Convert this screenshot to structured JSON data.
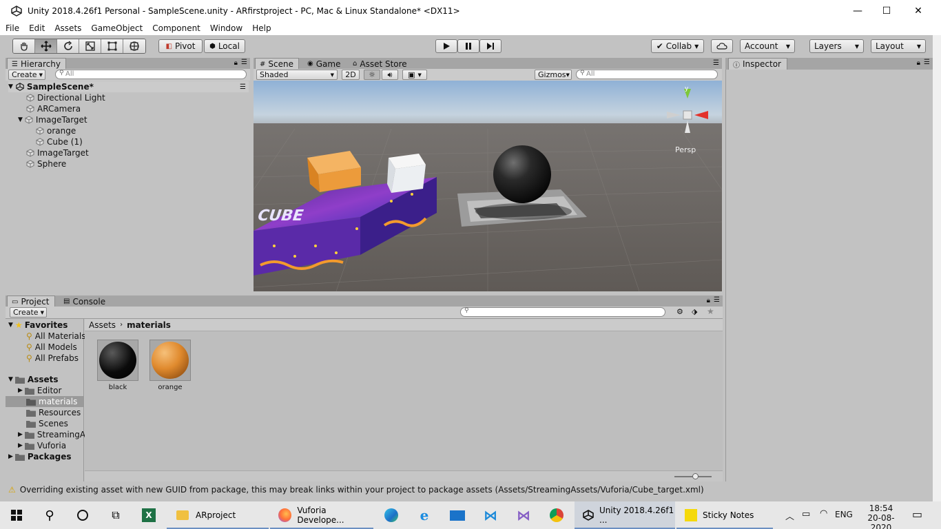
{
  "window": {
    "title": "Unity 2018.4.26f1 Personal - SampleScene.unity - ARfirstproject - PC, Mac & Linux Standalone* <DX11>",
    "minimize": "—",
    "maximize": "☐",
    "close": "✕"
  },
  "menu": [
    "File",
    "Edit",
    "Assets",
    "GameObject",
    "Component",
    "Window",
    "Help"
  ],
  "toolbar": {
    "pivot_label": "Pivot",
    "local_label": "Local",
    "collab_label": "Collab",
    "account_label": "Account",
    "layers_label": "Layers",
    "layout_label": "Layout"
  },
  "hierarchy": {
    "tab_label": "Hierarchy",
    "create_label": "Create",
    "search_placeholder": "All",
    "scene_name": "SampleScene*",
    "items": [
      {
        "label": "Directional Light",
        "indent": 0
      },
      {
        "label": "ARCamera",
        "indent": 0
      },
      {
        "label": "ImageTarget",
        "indent": 0
      },
      {
        "label": "orange",
        "indent": 1
      },
      {
        "label": "Cube (1)",
        "indent": 1
      },
      {
        "label": "ImageTarget",
        "indent": 0
      },
      {
        "label": "Sphere",
        "indent": 0
      }
    ]
  },
  "scene": {
    "tabs": [
      "Scene",
      "Game",
      "Asset Store"
    ],
    "shading_mode": "Shaded",
    "mode_2d": "2D",
    "gizmos_label": "Gizmos",
    "search_placeholder": "All",
    "persp_label": "Persp",
    "axis_y": "y",
    "target_text": "CUBE"
  },
  "inspector": {
    "tab_label": "Inspector"
  },
  "project": {
    "tabs": [
      "Project",
      "Console"
    ],
    "create_label": "Create",
    "favorites_label": "Favorites",
    "favorites": [
      "All Materials",
      "All Models",
      "All Prefabs"
    ],
    "assets_label": "Assets",
    "folders": [
      "Editor",
      "materials",
      "Resources",
      "Scenes",
      "StreamingA",
      "Vuforia"
    ],
    "packages_label": "Packages",
    "breadcrumb": [
      "Assets",
      "materials"
    ],
    "materials": [
      {
        "name": "black",
        "color": "#0b0b0b"
      },
      {
        "name": "orange",
        "color": "#e08a2e"
      }
    ]
  },
  "status": {
    "message": "Overriding existing asset with new GUID from package, this may break links within your project to package assets (Assets/StreamingAssets/Vuforia/Cube_target.xml)"
  },
  "taskbar": {
    "items": [
      {
        "label": "ARproject",
        "icon": "folder-icon"
      },
      {
        "label": "Vuforia Develope...",
        "icon": "firefox-icon"
      },
      {
        "label": "Unity 2018.4.26f1 ...",
        "icon": "unity-icon"
      },
      {
        "label": "Sticky Notes",
        "icon": "sticky-notes-icon"
      }
    ],
    "language": "ENG",
    "time": "18:54",
    "date": "20-08-2020"
  },
  "colors": {
    "editor_bg": "#c2c2c2",
    "accent_blue": "#3d7de0",
    "warning_yellow": "#f2c21b"
  }
}
